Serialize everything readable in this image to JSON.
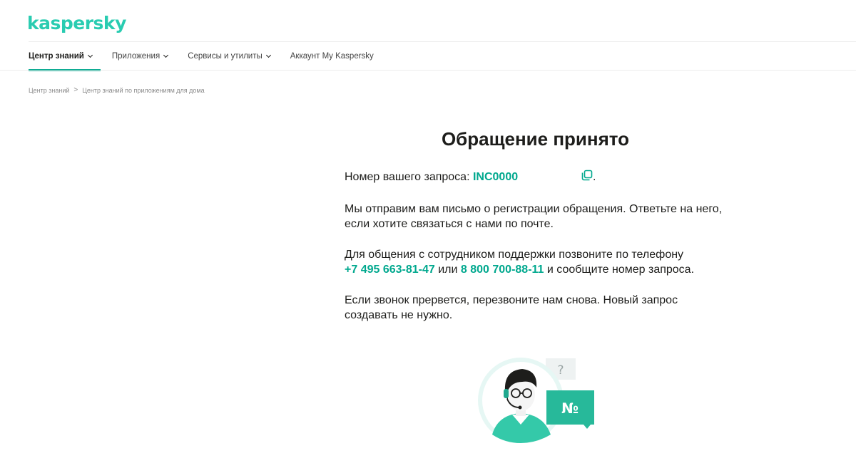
{
  "header": {
    "logo": "kaspersky"
  },
  "nav": {
    "items": [
      {
        "label": "Центр знаний"
      },
      {
        "label": "Приложения"
      },
      {
        "label": "Сервисы и утилиты"
      },
      {
        "label": "Аккаунт My Kaspersky"
      }
    ]
  },
  "breadcrumb": {
    "items": [
      "Центр знаний",
      "Центр знаний по приложениям для дома"
    ],
    "separator": ">"
  },
  "main": {
    "title": "Обращение принято",
    "request_label": "Номер вашего запроса: ",
    "request_number": "INC0000",
    "request_end": ".",
    "email_text": "Мы отправим вам письмо о регистрации обращения. Ответьте на него, если хотите связаться с нами по почте.",
    "call_text_1": "Для общения с сотрудником поддержки позвоните по телефону",
    "phone_1": "+7 495 663-81-47",
    "call_or": " или ",
    "phone_2": "8 800 700-88-11",
    "call_text_2": " и сообщите номер запроса.",
    "redial_text": "Если звонок прервется, перезвоните нам снова. Новый запрос создавать не нужно."
  },
  "illustration": {
    "question_mark": "?",
    "number_sign": "№"
  },
  "colors": {
    "brand": "#29ccb1",
    "accent": "#00a88e",
    "text": "#1d1d1b"
  },
  "icons": {
    "copy": "copy-icon",
    "chevron": "chevron-down-icon"
  }
}
